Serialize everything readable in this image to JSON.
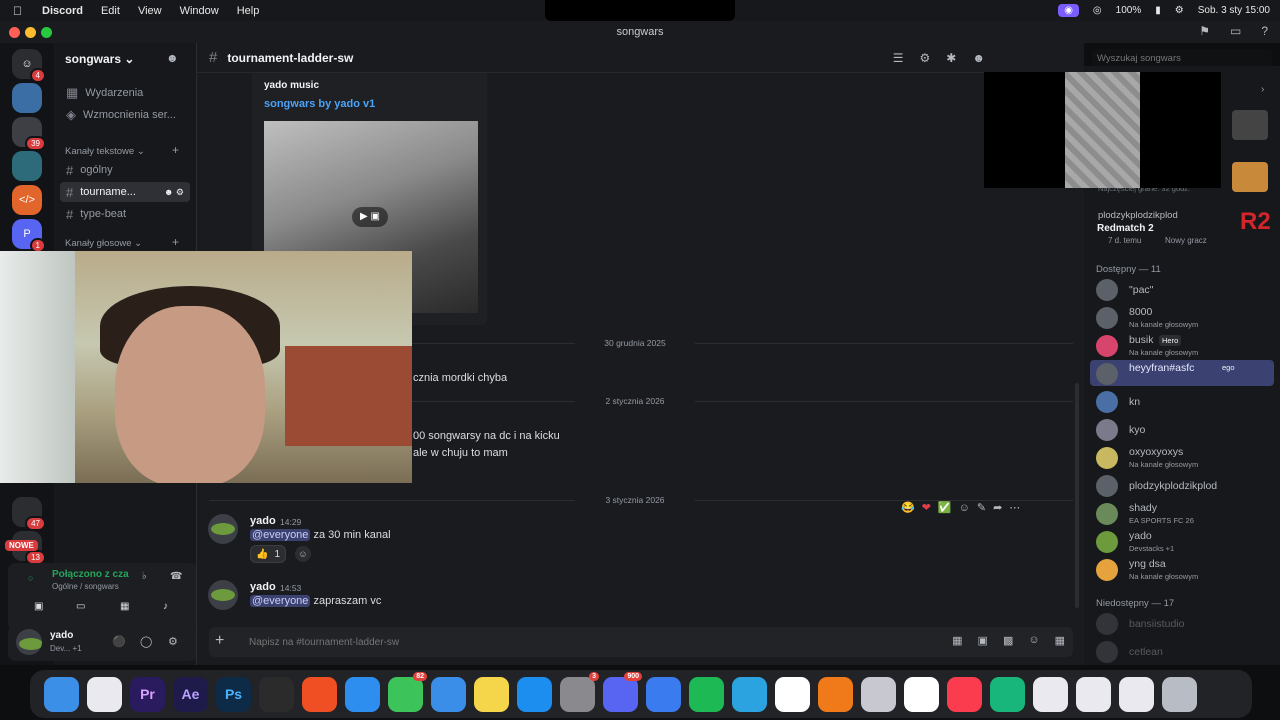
{
  "menubar": {
    "app": "Discord",
    "items": [
      "Edit",
      "View",
      "Window",
      "Help"
    ],
    "battery": "100%",
    "datetime": "Sob. 3 sty  15:00"
  },
  "window": {
    "title": "songwars"
  },
  "server": {
    "name": "songwars",
    "nav": [
      {
        "label": "Wydarzenia",
        "icon": "calendar-icon"
      },
      {
        "label": "Wzmocnienia ser...",
        "icon": "boost-icon"
      }
    ],
    "text_category": "Kanały tekstowe",
    "voice_category": "Kanały głosowe",
    "channels": [
      {
        "name": "ogólny",
        "active": false
      },
      {
        "name": "tourname...",
        "active": true
      },
      {
        "name": "type-beat",
        "active": false
      }
    ],
    "server_badges": [
      "4",
      "39",
      "1",
      "47",
      "13"
    ],
    "new_label": "NOWE"
  },
  "channel": {
    "name": "tournament-ladder-sw",
    "search_placeholder": "Wyszukaj songwars",
    "composer_placeholder": "Napisz na #tournament-ladder-sw"
  },
  "embed": {
    "provider": "yado music",
    "title": "songwars by yado v1"
  },
  "dividers": [
    "30 grudnia 2025",
    "2 stycznia 2026",
    "3 stycznia 2026"
  ],
  "partial_messages": [
    "cznia mordki chyba",
    "00 songwarsy na dc i na kicku",
    "ale w chuju to mam"
  ],
  "messages": [
    {
      "author": "yado",
      "time": "14:29",
      "mention": "@everyone",
      "text": "za 30 min kanal",
      "reaction_count": "1"
    },
    {
      "author": "yado",
      "time": "14:53",
      "mention": "@everyone",
      "text": "zapraszam vc"
    }
  ],
  "voice": {
    "status": "Połączono z czа",
    "location": "Ogólne / songwars"
  },
  "user": {
    "name": "yado",
    "status": "Dev... +1"
  },
  "members": {
    "activity_top": {
      "name": "plodzykplodzikplod",
      "game": "Redmatch 2",
      "detail1": "7 d. temu",
      "detail2": "Nowy gracz",
      "tag": "R2",
      "hidden_line": "Najczęściej grane: 32 godz."
    },
    "online_header": "Dostępny — 11",
    "online": [
      {
        "name": "\"pac\"",
        "sub": ""
      },
      {
        "name": "8000",
        "sub": "Na kanale głosowym"
      },
      {
        "name": "busik",
        "sub": "Na kanale głosowym",
        "tag": "Hero"
      },
      {
        "name": "heyyfran#asfc",
        "sub": "",
        "tag": "ego"
      },
      {
        "name": "kn",
        "sub": ""
      },
      {
        "name": "kyo",
        "sub": ""
      },
      {
        "name": "oxyoxyoxys",
        "sub": "Na kanale głosowym"
      },
      {
        "name": "plodzykplodzikplod",
        "sub": ""
      },
      {
        "name": "shady",
        "sub": "EA SPORTS FC 26"
      },
      {
        "name": "yado",
        "sub": "Devstacks +1"
      },
      {
        "name": "yng dsa",
        "sub": "Na kanale głosowym"
      }
    ],
    "offline_header": "Niedostępny — 17",
    "offline": [
      {
        "name": "bansiistudio"
      },
      {
        "name": "cetlean"
      }
    ]
  },
  "dock": [
    {
      "label": "Finder",
      "color": "#3b8fe6",
      "badge": ""
    },
    {
      "label": "Launchpad",
      "color": "#e9e9ef",
      "badge": ""
    },
    {
      "label": "Pr",
      "color": "#2a1a5e",
      "badge": ""
    },
    {
      "label": "Ae",
      "color": "#1e1a4a",
      "badge": ""
    },
    {
      "label": "Ps",
      "color": "#0d2a46",
      "badge": ""
    },
    {
      "label": "Blender",
      "color": "#2b2b2b",
      "badge": ""
    },
    {
      "label": "Brave",
      "color": "#f04e23",
      "badge": ""
    },
    {
      "label": "Safari",
      "color": "#2e8ef0",
      "badge": ""
    },
    {
      "label": "Messages",
      "color": "#3cc45a",
      "badge": "82"
    },
    {
      "label": "Mail",
      "color": "#3a8ee8",
      "badge": ""
    },
    {
      "label": "Notes",
      "color": "#f5d54a",
      "badge": ""
    },
    {
      "label": "App Store",
      "color": "#1c8ef0",
      "badge": ""
    },
    {
      "label": "Settings",
      "color": "#8a8a8e",
      "badge": "3"
    },
    {
      "label": "Discord",
      "color": "#5865f2",
      "badge": "900"
    },
    {
      "label": "Roblox",
      "color": "#3a7bf0",
      "badge": ""
    },
    {
      "label": "Spotify",
      "color": "#1db954",
      "badge": ""
    },
    {
      "label": "Telegram",
      "color": "#2aa3e0",
      "badge": ""
    },
    {
      "label": "Slack",
      "color": "#ffffff",
      "badge": ""
    },
    {
      "label": "FL Studio",
      "color": "#f07a1a",
      "badge": ""
    },
    {
      "label": "CleanMyMac",
      "color": "#c8c8d0",
      "badge": ""
    },
    {
      "label": "Quick",
      "color": "#ffffff",
      "badge": ""
    },
    {
      "label": "Music",
      "color": "#fa3c4e",
      "badge": ""
    },
    {
      "label": "Chat",
      "color": "#19b67c",
      "badge": ""
    },
    {
      "label": "Doc",
      "color": "#e9e9ef",
      "badge": ""
    },
    {
      "label": "Doc",
      "color": "#e9e9ef",
      "badge": ""
    },
    {
      "label": "Audio",
      "color": "#e9e9ef",
      "badge": ""
    },
    {
      "label": "Trash",
      "color": "#b8bcc4",
      "badge": ""
    }
  ]
}
